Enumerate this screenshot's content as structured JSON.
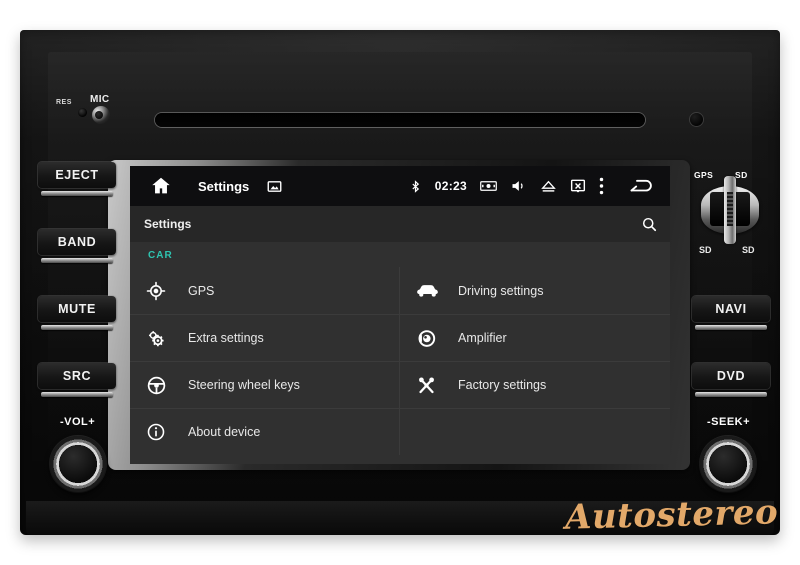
{
  "device": {
    "labels": {
      "res": "RES",
      "mic": "MIC",
      "gps": "GPS",
      "sd": "SD",
      "sd_symbol_left": "SD",
      "sd_symbol_right": "SD"
    },
    "left_buttons": [
      {
        "label": "EJECT"
      },
      {
        "label": "BAND"
      },
      {
        "label": "MUTE"
      },
      {
        "label": "SRC"
      }
    ],
    "right_buttons": [
      {
        "label": "NAVI"
      },
      {
        "label": "DVD"
      }
    ],
    "knobs": [
      {
        "label": "-VOL+",
        "name": "volume-knob"
      },
      {
        "label": "-SEEK+",
        "name": "seek-knob"
      }
    ]
  },
  "screen": {
    "statusbar": {
      "home_icon": "home-icon",
      "title": "Settings",
      "wallpaper_icon": "picture-icon",
      "bluetooth_icon": "bluetooth-icon",
      "time": "02:23",
      "camera_icon": "camera-icon",
      "volume_icon": "volume-icon",
      "eject_icon": "eject-icon",
      "screen_off_icon": "screen-off-icon",
      "overflow_icon": "overflow-menu-icon",
      "back_icon": "back-icon"
    },
    "actionbar": {
      "title": "Settings",
      "search_icon": "search-icon"
    },
    "content": {
      "category": "CAR",
      "accent_color": "#2ec4b0",
      "left_column": [
        {
          "icon": "gps-icon",
          "label": "GPS"
        },
        {
          "icon": "extra-settings-icon",
          "label": "Extra settings"
        },
        {
          "icon": "steering-wheel-icon",
          "label": "Steering wheel keys"
        },
        {
          "icon": "about-device-icon",
          "label": "About device"
        }
      ],
      "right_column": [
        {
          "icon": "car-icon",
          "label": "Driving settings"
        },
        {
          "icon": "amplifier-icon",
          "label": "Amplifier"
        },
        {
          "icon": "factory-settings-icon",
          "label": "Factory settings"
        }
      ]
    }
  },
  "watermark": {
    "text": "Autostereo",
    "color": "#e2a869"
  }
}
